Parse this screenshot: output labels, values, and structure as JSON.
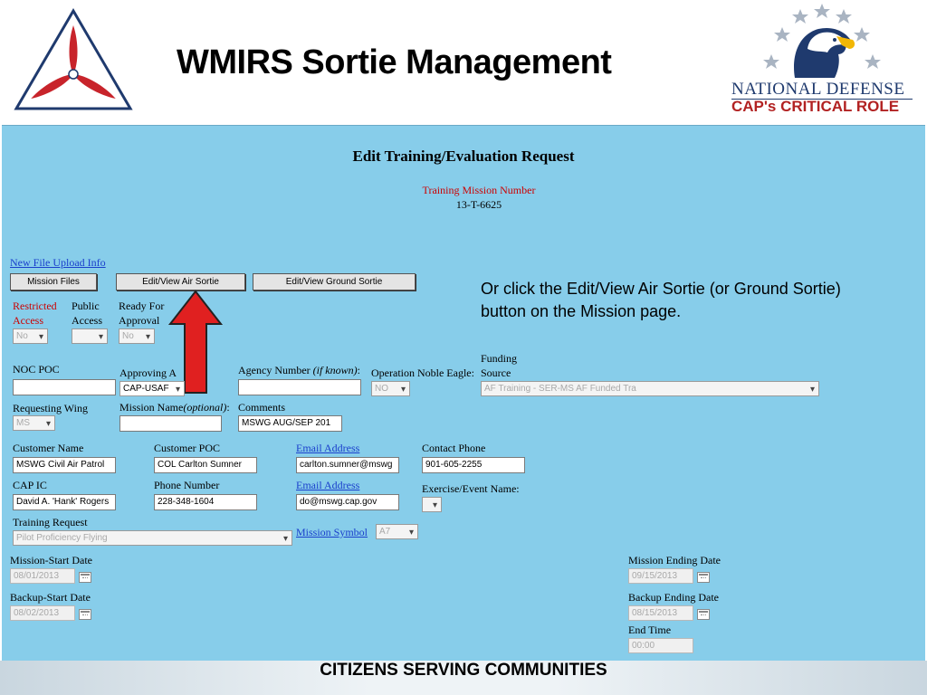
{
  "slide": {
    "title": "WMIRS Sortie Management",
    "badge_line1": "NATIONAL DEFENSE",
    "badge_line2": "CAP's CRITICAL ROLE",
    "footer": "CITIZENS SERVING COMMUNITIES",
    "note": "Or click the Edit/View Air Sortie (or Ground Sortie) button on the Mission page."
  },
  "colors": {
    "panel": "#87cdea",
    "arrow": "#e02020",
    "link": "#1a3fcc",
    "label_red": "#cc0000"
  },
  "form": {
    "heading": "Edit Training/Evaluation Request",
    "mission_number_label": "Training Mission Number",
    "mission_number": "13-T-6625",
    "upload_link": "New File Upload Info",
    "buttons": {
      "mission_files": "Mission Files",
      "air_sortie": "Edit/View Air Sortie",
      "ground_sortie": "Edit/View Ground Sortie"
    },
    "restricted_label_1": "Restricted",
    "restricted_label_2": "Access",
    "restricted_value": "No",
    "public_label_1": "Public",
    "public_label_2": "Access",
    "public_value": "",
    "ready_label_1": "Ready For",
    "ready_label_2": "Approval",
    "ready_value": "No",
    "noc_poc_label": "NOC POC",
    "noc_poc_value": "",
    "approving_label": "Approving A",
    "approving_value": "CAP-USAF",
    "agency_label": "Agency Number",
    "agency_label_italic": "(if known)",
    "agency_label_suffix": ":",
    "agency_value": "",
    "noble_eagle_label": "Operation Noble Eagle:",
    "noble_eagle_value": "NO",
    "funding_label_1": "Funding",
    "funding_label_2": "Source",
    "funding_value": "AF Training - SER-MS AF Funded Tra",
    "requesting_wing_label": "Requesting Wing",
    "requesting_wing_value": "MS",
    "mission_name_label": "Mission Name",
    "mission_name_label_italic": "(optional)",
    "mission_name_label_suffix": ":",
    "mission_name_value": "",
    "comments_label": "Comments",
    "comments_value": "MSWG AUG/SEP 201",
    "customer_name_label": "Customer Name",
    "customer_name_value": "MSWG Civil Air Patrol",
    "customer_poc_label": "Customer POC",
    "customer_poc_value": "COL Carlton Sumner",
    "email_label_1": "Email Address",
    "email_value_1": "carlton.sumner@mswg",
    "contact_phone_label": "Contact Phone",
    "contact_phone_value": "901-605-2255",
    "cap_ic_label": "CAP IC",
    "cap_ic_value": "David A. 'Hank' Rogers",
    "phone_label": "Phone Number",
    "phone_value": "228-348-1604",
    "email_label_2": "Email Address",
    "email_value_2": "do@mswg.cap.gov",
    "exercise_label": "Exercise/Event Name:",
    "exercise_value": "",
    "training_request_label": "Training Request",
    "training_request_value": "Pilot Proficiency Flying",
    "mission_symbol_label": "Mission Symbol",
    "mission_symbol_value": "A7",
    "start_date_label": "Mission-Start Date",
    "start_date_value": "08/01/2013",
    "backup_start_label": "Backup-Start Date",
    "backup_start_value": "08/02/2013",
    "end_date_label": "Mission Ending Date",
    "end_date_value": "09/15/2013",
    "backup_end_label": "Backup Ending Date",
    "backup_end_value": "08/15/2013",
    "end_time_label": "End Time",
    "end_time_value": "00:00"
  }
}
